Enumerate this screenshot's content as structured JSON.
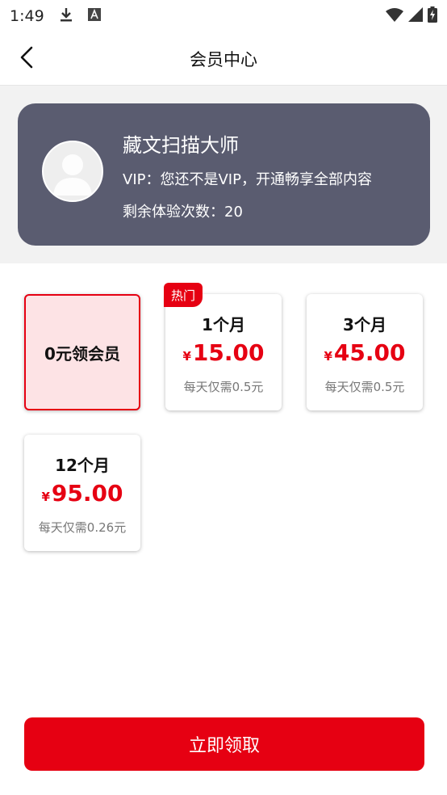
{
  "status_bar": {
    "time": "1:49",
    "icons": [
      "download-icon",
      "text-a-icon",
      "wifi-icon",
      "signal-icon",
      "battery-charging-icon"
    ]
  },
  "header": {
    "title": "会员中心",
    "back_icon": "chevron-left-icon"
  },
  "profile": {
    "name": "藏文扫描大师",
    "vip_status": "VIP：您还不是VIP，开通畅享全部内容",
    "remaining": "剩余体验次数：20",
    "avatar_icon": "user-avatar-icon"
  },
  "plans": [
    {
      "label": "0元领会员",
      "selected": true
    },
    {
      "period": "1个月",
      "currency": "¥",
      "price": "15.00",
      "daily": "每天仅需0.5元",
      "badge": "热门"
    },
    {
      "period": "3个月",
      "currency": "¥",
      "price": "45.00",
      "daily": "每天仅需0.5元"
    },
    {
      "period": "12个月",
      "currency": "¥",
      "price": "95.00",
      "daily": "每天仅需0.26元"
    }
  ],
  "action": {
    "label": "立即领取"
  },
  "colors": {
    "accent": "#e60012",
    "card": "#5a5c70",
    "selected_bg": "#fde3e5",
    "band": "#f2f2f2"
  }
}
